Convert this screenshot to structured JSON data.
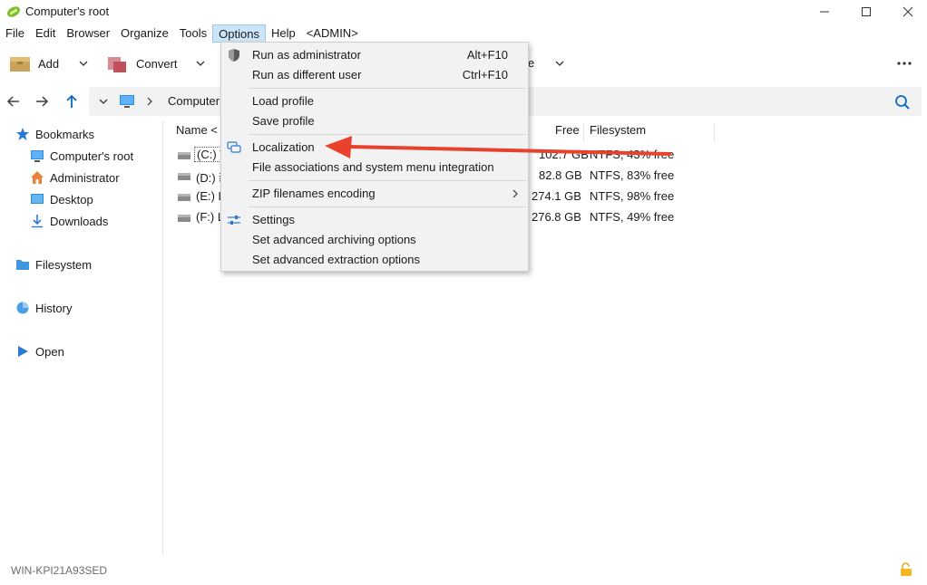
{
  "window": {
    "title": "Computer's root"
  },
  "menubar": [
    "File",
    "Edit",
    "Browser",
    "Organize",
    "Tools",
    "Options",
    "Help",
    "<ADMIN>"
  ],
  "toolbar": {
    "add_label": "Add",
    "convert_label": "Convert",
    "hidden_label_tail": "e"
  },
  "address": {
    "path": "Computer"
  },
  "sidebar": {
    "bookmarks": "Bookmarks",
    "items": [
      "Computer's root",
      "Administrator",
      "Desktop",
      "Downloads"
    ],
    "filesystem": "Filesystem",
    "history": "History",
    "open": "Open"
  },
  "columns": {
    "name": "Name <",
    "free": "Free",
    "filesystem": "Filesystem"
  },
  "drives": [
    {
      "name": "(C:) V",
      "free": "102.7 GB",
      "fs": "NTFS, 43% free"
    },
    {
      "name": "(D:) 新",
      "free": "82.8 GB",
      "fs": "NTFS, 83% free"
    },
    {
      "name": "(E:) L",
      "free": "274.1 GB",
      "fs": "NTFS, 98% free"
    },
    {
      "name": "(F:) L",
      "free": "276.8 GB",
      "fs": "NTFS, 49% free"
    }
  ],
  "options_menu": {
    "run_admin": "Run as administrator",
    "run_admin_accel": "Alt+F10",
    "run_diff": "Run as different user",
    "run_diff_accel": "Ctrl+F10",
    "load_profile": "Load profile",
    "save_profile": "Save profile",
    "localization": "Localization",
    "file_assoc": "File associations and system menu integration",
    "zip_encoding": "ZIP filenames encoding",
    "settings": "Settings",
    "adv_archiving": "Set advanced archiving options",
    "adv_extraction": "Set advanced extraction options"
  },
  "status": {
    "computer_name": "WIN-KPI21A93SED"
  },
  "colors": {
    "accent": "#0a6ac9",
    "annotation_arrow": "#e8412c",
    "menu_highlight": "#cce4f7"
  }
}
